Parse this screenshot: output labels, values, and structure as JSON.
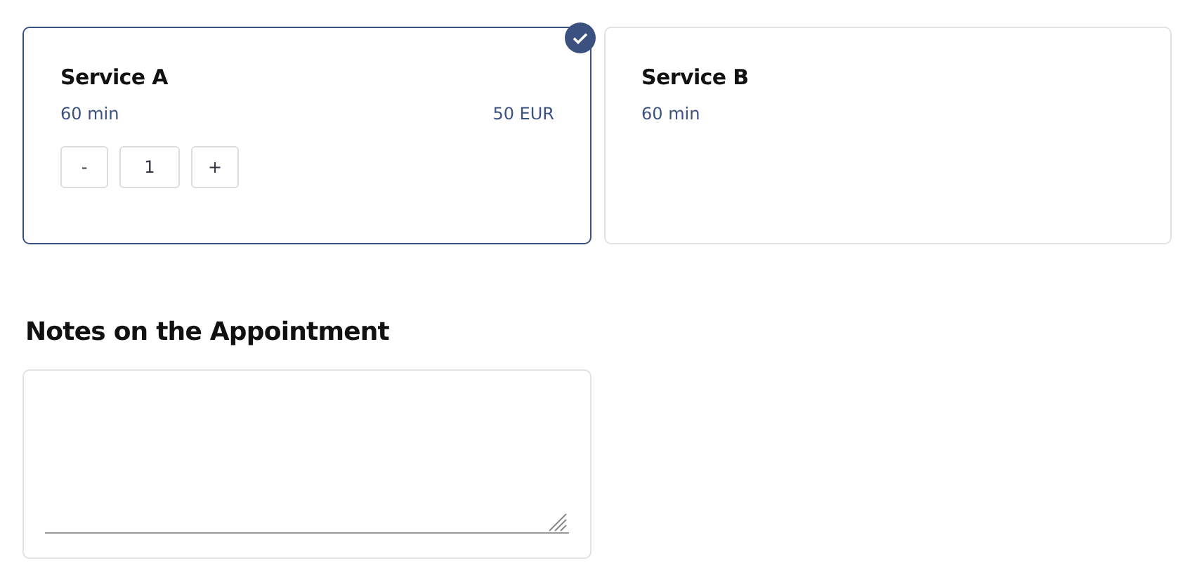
{
  "services": [
    {
      "name": "Service A",
      "duration": "60 min",
      "price": "50 EUR",
      "selected": true,
      "stepper": {
        "minus": "-",
        "quantity": "1",
        "plus": "+"
      }
    },
    {
      "name": "Service B",
      "duration": "60 min",
      "selected": false
    }
  ],
  "notes": {
    "heading": "Notes on the Appointment"
  }
}
